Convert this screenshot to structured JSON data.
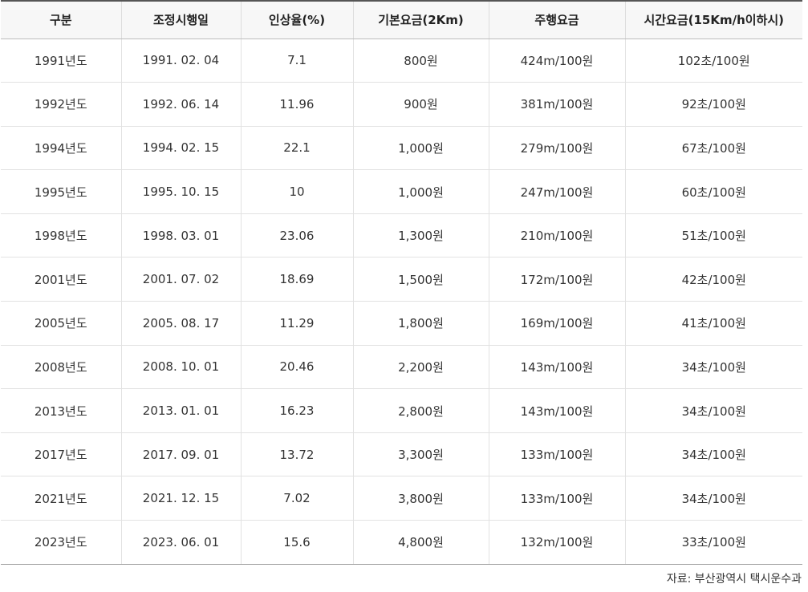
{
  "table": {
    "headers": [
      "구분",
      "조정시행일",
      "인상율(%)",
      "기본요금(2Km)",
      "주행요금",
      "시간요금(15Km/h이하시)"
    ],
    "rows": [
      [
        "1991년도",
        "1991. 02. 04",
        "7.1",
        "800원",
        "424m/100원",
        "102초/100원"
      ],
      [
        "1992년도",
        "1992. 06. 14",
        "11.96",
        "900원",
        "381m/100원",
        "92초/100원"
      ],
      [
        "1994년도",
        "1994. 02. 15",
        "22.1",
        "1,000원",
        "279m/100원",
        "67초/100원"
      ],
      [
        "1995년도",
        "1995. 10. 15",
        "10",
        "1,000원",
        "247m/100원",
        "60초/100원"
      ],
      [
        "1998년도",
        "1998. 03. 01",
        "23.06",
        "1,300원",
        "210m/100원",
        "51초/100원"
      ],
      [
        "2001년도",
        "2001. 07. 02",
        "18.69",
        "1,500원",
        "172m/100원",
        "42초/100원"
      ],
      [
        "2005년도",
        "2005. 08. 17",
        "11.29",
        "1,800원",
        "169m/100원",
        "41초/100원"
      ],
      [
        "2008년도",
        "2008. 10. 01",
        "20.46",
        "2,200원",
        "143m/100원",
        "34초/100원"
      ],
      [
        "2013년도",
        "2013. 01. 01",
        "16.23",
        "2,800원",
        "143m/100원",
        "34초/100원"
      ],
      [
        "2017년도",
        "2017. 09. 01",
        "13.72",
        "3,300원",
        "133m/100원",
        "34초/100원"
      ],
      [
        "2021년도",
        "2021. 12. 15",
        "7.02",
        "3,800원",
        "133m/100원",
        "34초/100원"
      ],
      [
        "2023년도",
        "2023. 06. 01",
        "15.6",
        "4,800원",
        "132m/100원",
        "33초/100원"
      ]
    ]
  },
  "source": "자료: 부산광역시 택시운수과"
}
